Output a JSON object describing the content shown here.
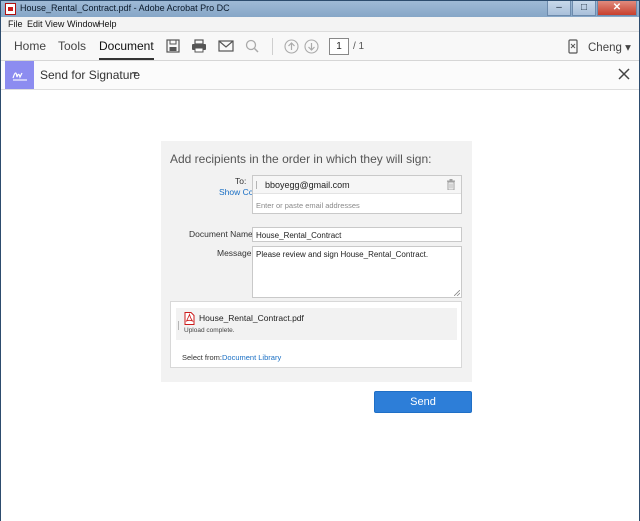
{
  "window": {
    "title": "House_Rental_Contract.pdf - Adobe Acrobat Pro DC",
    "min_glyph": "–",
    "max_glyph": "□",
    "close_glyph": "✕"
  },
  "menubar": {
    "items": [
      "File",
      "Edit",
      "View",
      "Window",
      "Help"
    ]
  },
  "toolbar": {
    "tabs": [
      {
        "label": "Home",
        "active": false
      },
      {
        "label": "Tools",
        "active": false
      },
      {
        "label": "Document",
        "active": true
      }
    ],
    "icons": [
      "save-icon",
      "print-icon",
      "email-icon",
      "search-icon",
      "page-up-icon",
      "page-down-icon"
    ],
    "page_current": "1",
    "page_total": "/ 1",
    "user_icon": "mobile-device-icon",
    "user_name": "Cheng",
    "user_caret": "▾"
  },
  "task": {
    "icon": "signature-icon",
    "title": "Send for Signature",
    "close_icon": "close-icon"
  },
  "form": {
    "heading": "Add recipients in the order in which they will sign:",
    "to_label": "To:",
    "show_cc": "Show Cc",
    "recipients": [
      "bboyegg@gmail.com"
    ],
    "recipient_placeholder": "Enter or paste email addresses",
    "doc_name_label": "Document Name:",
    "doc_name_value": "House_Rental_Contract",
    "message_label": "Message:",
    "message_value": "Please review and sign House_Rental_Contract.",
    "attachment": {
      "icon": "pdf-file-icon",
      "name": "House_Rental_Contract.pdf",
      "status": "Upload complete."
    },
    "select_from_label": "Select from:",
    "document_library": "Document Library",
    "send_label": "Send"
  },
  "colors": {
    "accent_blue": "#2d7ed8",
    "link_blue": "#1a6fc4",
    "signature_tab": "#8c8cf0",
    "pdf_red": "#cc1b1b"
  }
}
